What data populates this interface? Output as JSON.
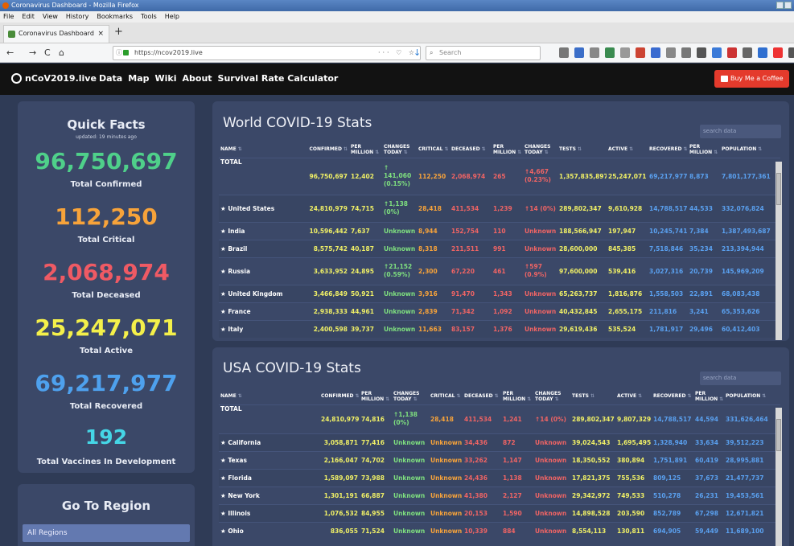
{
  "browser": {
    "window_title": "Coronavirus Dashboard - Mozilla Firefox",
    "menu": [
      "File",
      "Edit",
      "View",
      "History",
      "Bookmarks",
      "Tools",
      "Help"
    ],
    "tab_title": "Coronavirus Dashboard",
    "tab_close": "×",
    "new_tab": "+",
    "url": "https://ncov2019.live",
    "search_placeholder": "Search",
    "url_actions": "··· ♡ ☆",
    "nav": {
      "back": "←",
      "forward": "→",
      "reload": "C",
      "home": "⌂",
      "download": "↓"
    }
  },
  "site": {
    "brand": "nCoV2019.live",
    "links": [
      "Data",
      "Map",
      "Wiki",
      "About",
      "Survival Rate Calculator"
    ],
    "coffee_button": "Buy Me a Coffee"
  },
  "quick_facts": {
    "title": "Quick Facts",
    "updated": "updated: 19 minutes ago",
    "stats": [
      {
        "value": "96,750,697",
        "label": "Total Confirmed",
        "color": "#4fd08a"
      },
      {
        "value": "112,250",
        "label": "Total Critical",
        "color": "#f7a33a"
      },
      {
        "value": "2,068,974",
        "label": "Total Deceased",
        "color": "#ef5a64"
      },
      {
        "value": "25,247,071",
        "label": "Total Active",
        "color": "#f4f04a"
      },
      {
        "value": "69,217,977",
        "label": "Total Recovered",
        "color": "#4ea1ee"
      },
      {
        "value": "192",
        "label": "Total Vaccines In Development",
        "color": "#45d6e6"
      }
    ]
  },
  "go_region": {
    "title": "Go To Region",
    "selected": "All Regions"
  },
  "world": {
    "title": "World COVID-19 Stats",
    "search_placeholder": "search data",
    "headers": [
      "NAME",
      "CONFIRMED",
      "PER MILLION",
      "CHANGES TODAY",
      "CRITICAL",
      "DECEASED",
      "PER MILLION",
      "CHANGES TODAY",
      "TESTS",
      "ACTIVE",
      "RECOVERED",
      "PER MILLION",
      "POPULATION"
    ],
    "rows": [
      {
        "name": "TOTAL",
        "star": false,
        "confirmed": "96,750,697",
        "pm": "12,402",
        "chg": "↑ 141,060 (0.15%)",
        "critical": "112,250",
        "deceased": "2,068,974",
        "pmd": "265",
        "chgd": "↑4,667 (0.23%)",
        "tests": "1,357,835,897",
        "active": "25,247,071",
        "recovered": "69,217,977",
        "pmr": "8,873",
        "population": "7,801,177,361"
      },
      {
        "name": "United States",
        "star": true,
        "confirmed": "24,810,979",
        "pm": "74,715",
        "chg": "↑1,138 (0%)",
        "critical": "28,418",
        "deceased": "411,534",
        "pmd": "1,239",
        "chgd": "↑14 (0%)",
        "tests": "289,802,347",
        "active": "9,610,928",
        "recovered": "14,788,517",
        "pmr": "44,533",
        "population": "332,076,824"
      },
      {
        "name": "India",
        "star": true,
        "confirmed": "10,596,442",
        "pm": "7,637",
        "chg": "Unknown",
        "critical": "8,944",
        "deceased": "152,754",
        "pmd": "110",
        "chgd": "Unknown",
        "tests": "188,566,947",
        "active": "197,947",
        "recovered": "10,245,741",
        "pmr": "7,384",
        "population": "1,387,493,687"
      },
      {
        "name": "Brazil",
        "star": true,
        "confirmed": "8,575,742",
        "pm": "40,187",
        "chg": "Unknown",
        "critical": "8,318",
        "deceased": "211,511",
        "pmd": "991",
        "chgd": "Unknown",
        "tests": "28,600,000",
        "active": "845,385",
        "recovered": "7,518,846",
        "pmr": "35,234",
        "population": "213,394,944"
      },
      {
        "name": "Russia",
        "star": true,
        "confirmed": "3,633,952",
        "pm": "24,895",
        "chg": "↑21,152 (0.59%)",
        "critical": "2,300",
        "deceased": "67,220",
        "pmd": "461",
        "chgd": "↑597 (0.9%)",
        "tests": "97,600,000",
        "active": "539,416",
        "recovered": "3,027,316",
        "pmr": "20,739",
        "population": "145,969,209"
      },
      {
        "name": "United Kingdom",
        "star": true,
        "confirmed": "3,466,849",
        "pm": "50,921",
        "chg": "Unknown",
        "critical": "3,916",
        "deceased": "91,470",
        "pmd": "1,343",
        "chgd": "Unknown",
        "tests": "65,263,737",
        "active": "1,816,876",
        "recovered": "1,558,503",
        "pmr": "22,891",
        "population": "68,083,438"
      },
      {
        "name": "France",
        "star": true,
        "confirmed": "2,938,333",
        "pm": "44,961",
        "chg": "Unknown",
        "critical": "2,839",
        "deceased": "71,342",
        "pmd": "1,092",
        "chgd": "Unknown",
        "tests": "40,432,845",
        "active": "2,655,175",
        "recovered": "211,816",
        "pmr": "3,241",
        "population": "65,353,626"
      },
      {
        "name": "Italy",
        "star": true,
        "confirmed": "2,400,598",
        "pm": "39,737",
        "chg": "Unknown",
        "critical": "11,663",
        "deceased": "83,157",
        "pmd": "1,376",
        "chgd": "Unknown",
        "tests": "29,619,436",
        "active": "535,524",
        "recovered": "1,781,917",
        "pmr": "29,496",
        "population": "60,412,403"
      }
    ]
  },
  "usa": {
    "title": "USA COVID-19 Stats",
    "search_placeholder": "search data",
    "headers": [
      "NAME",
      "CONFIRMED",
      "PER MILLION",
      "CHANGES TODAY",
      "CRITICAL",
      "DECEASED",
      "PER MILLION",
      "CHANGES TODAY",
      "TESTS",
      "ACTIVE",
      "RECOVERED",
      "PER MILLION",
      "POPULATION"
    ],
    "rows": [
      {
        "name": "TOTAL",
        "star": false,
        "confirmed": "24,810,979",
        "pm": "74,816",
        "chg": "↑1,138 (0%)",
        "critical": "28,418",
        "deceased": "411,534",
        "pmd": "1,241",
        "chgd": "↑14 (0%)",
        "tests": "289,802,347",
        "active": "9,807,329",
        "recovered": "14,788,517",
        "pmr": "44,594",
        "population": "331,626,464"
      },
      {
        "name": "California",
        "star": true,
        "confirmed": "3,058,871",
        "pm": "77,416",
        "chg": "Unknown",
        "critical": "Unknown",
        "deceased": "34,436",
        "pmd": "872",
        "chgd": "Unknown",
        "tests": "39,024,543",
        "active": "1,695,495",
        "recovered": "1,328,940",
        "pmr": "33,634",
        "population": "39,512,223"
      },
      {
        "name": "Texas",
        "star": true,
        "confirmed": "2,166,047",
        "pm": "74,702",
        "chg": "Unknown",
        "critical": "Unknown",
        "deceased": "33,262",
        "pmd": "1,147",
        "chgd": "Unknown",
        "tests": "18,350,552",
        "active": "380,894",
        "recovered": "1,751,891",
        "pmr": "60,419",
        "population": "28,995,881"
      },
      {
        "name": "Florida",
        "star": true,
        "confirmed": "1,589,097",
        "pm": "73,988",
        "chg": "Unknown",
        "critical": "Unknown",
        "deceased": "24,436",
        "pmd": "1,138",
        "chgd": "Unknown",
        "tests": "17,821,375",
        "active": "755,536",
        "recovered": "809,125",
        "pmr": "37,673",
        "population": "21,477,737"
      },
      {
        "name": "New York",
        "star": true,
        "confirmed": "1,301,191",
        "pm": "66,887",
        "chg": "Unknown",
        "critical": "Unknown",
        "deceased": "41,380",
        "pmd": "2,127",
        "chgd": "Unknown",
        "tests": "29,342,972",
        "active": "749,533",
        "recovered": "510,278",
        "pmr": "26,231",
        "population": "19,453,561"
      },
      {
        "name": "Illinois",
        "star": true,
        "confirmed": "1,076,532",
        "pm": "84,955",
        "chg": "Unknown",
        "critical": "Unknown",
        "deceased": "20,153",
        "pmd": "1,590",
        "chgd": "Unknown",
        "tests": "14,898,528",
        "active": "203,590",
        "recovered": "852,789",
        "pmr": "67,298",
        "population": "12,671,821"
      },
      {
        "name": "Ohio",
        "star": true,
        "confirmed": "836,055",
        "pm": "71,524",
        "chg": "Unknown",
        "critical": "Unknown",
        "deceased": "10,339",
        "pmd": "884",
        "chgd": "Unknown",
        "tests": "8,554,113",
        "active": "130,811",
        "recovered": "694,905",
        "pmr": "59,449",
        "population": "11,689,100"
      }
    ]
  }
}
